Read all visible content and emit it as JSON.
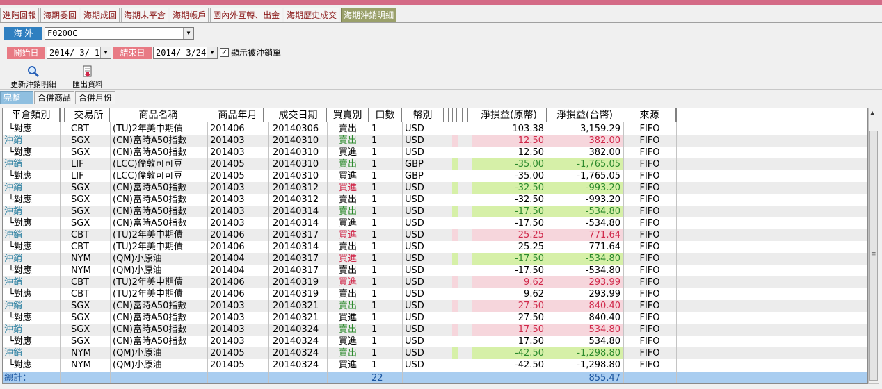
{
  "tabs": [
    "進階回報",
    "海期委回",
    "海期成回",
    "海期未平倉",
    "海期帳戶",
    "國內外互轉、出金",
    "海期歷史成交",
    "海期沖銷明細"
  ],
  "active_tab": 7,
  "market_label": "海 外",
  "account_value": "F0200C",
  "start_label": "開始日",
  "start_date": "2014/ 3/ 1",
  "end_label": "結束日",
  "end_date": "2014/ 3/24",
  "show_offset_label": "顯示被沖銷單",
  "show_offset_checked": true,
  "toolbar": {
    "refresh_label": "更新沖銷明細",
    "export_label": "匯出資料"
  },
  "subtabs": [
    "完整",
    "合併商品",
    "合併月份"
  ],
  "columns": [
    "平倉類別",
    "交易所",
    "商品名稱",
    "商品年月",
    "成交日期",
    "買賣別",
    "口數",
    "幣別",
    "淨損益(原幣)",
    "淨損益(台幣)",
    "來源"
  ],
  "rows": [
    {
      "type": "└對應",
      "ex": "CBT",
      "name": "(TU)2年美中期債",
      "ym": "201406",
      "date": "20140306",
      "side": "賣出",
      "qty": "1",
      "cur": "USD",
      "pl": "103.38",
      "twd": "3,159.29",
      "src": "FIFO",
      "kind": "match"
    },
    {
      "type": "沖銷",
      "ex": "SGX",
      "name": "(CN)富時A50指數",
      "ym": "201403",
      "date": "20140310",
      "side": "賣出",
      "qty": "1",
      "cur": "USD",
      "pl": "12.50",
      "twd": "382.00",
      "src": "FIFO",
      "kind": "offset",
      "sign": "pos"
    },
    {
      "type": "└對應",
      "ex": "SGX",
      "name": "(CN)富時A50指數",
      "ym": "201403",
      "date": "20140310",
      "side": "買進",
      "qty": "1",
      "cur": "USD",
      "pl": "12.50",
      "twd": "382.00",
      "src": "FIFO",
      "kind": "match"
    },
    {
      "type": "沖銷",
      "ex": "LIF",
      "name": "(LCC)倫敦可可豆",
      "ym": "201405",
      "date": "20140310",
      "side": "賣出",
      "qty": "1",
      "cur": "GBP",
      "pl": "-35.00",
      "twd": "-1,765.05",
      "src": "FIFO",
      "kind": "offset",
      "sign": "neg"
    },
    {
      "type": "└對應",
      "ex": "LIF",
      "name": "(LCC)倫敦可可豆",
      "ym": "201405",
      "date": "20140310",
      "side": "買進",
      "qty": "1",
      "cur": "GBP",
      "pl": "-35.00",
      "twd": "-1,765.05",
      "src": "FIFO",
      "kind": "match"
    },
    {
      "type": "沖銷",
      "ex": "SGX",
      "name": "(CN)富時A50指數",
      "ym": "201403",
      "date": "20140312",
      "side": "買進",
      "qty": "1",
      "cur": "USD",
      "pl": "-32.50",
      "twd": "-993.20",
      "src": "FIFO",
      "kind": "offset",
      "sign": "neg"
    },
    {
      "type": "└對應",
      "ex": "SGX",
      "name": "(CN)富時A50指數",
      "ym": "201403",
      "date": "20140312",
      "side": "賣出",
      "qty": "1",
      "cur": "USD",
      "pl": "-32.50",
      "twd": "-993.20",
      "src": "FIFO",
      "kind": "match"
    },
    {
      "type": "沖銷",
      "ex": "SGX",
      "name": "(CN)富時A50指數",
      "ym": "201403",
      "date": "20140314",
      "side": "賣出",
      "qty": "1",
      "cur": "USD",
      "pl": "-17.50",
      "twd": "-534.80",
      "src": "FIFO",
      "kind": "offset",
      "sign": "neg"
    },
    {
      "type": "└對應",
      "ex": "SGX",
      "name": "(CN)富時A50指數",
      "ym": "201403",
      "date": "20140314",
      "side": "買進",
      "qty": "1",
      "cur": "USD",
      "pl": "-17.50",
      "twd": "-534.80",
      "src": "FIFO",
      "kind": "match"
    },
    {
      "type": "沖銷",
      "ex": "CBT",
      "name": "(TU)2年美中期債",
      "ym": "201406",
      "date": "20140317",
      "side": "買進",
      "qty": "1",
      "cur": "USD",
      "pl": "25.25",
      "twd": "771.64",
      "src": "FIFO",
      "kind": "offset",
      "sign": "pos"
    },
    {
      "type": "└對應",
      "ex": "CBT",
      "name": "(TU)2年美中期債",
      "ym": "201406",
      "date": "20140314",
      "side": "賣出",
      "qty": "1",
      "cur": "USD",
      "pl": "25.25",
      "twd": "771.64",
      "src": "FIFO",
      "kind": "match"
    },
    {
      "type": "沖銷",
      "ex": "NYM",
      "name": "(QM)小原油",
      "ym": "201404",
      "date": "20140317",
      "side": "買進",
      "qty": "1",
      "cur": "USD",
      "pl": "-17.50",
      "twd": "-534.80",
      "src": "FIFO",
      "kind": "offset",
      "sign": "neg"
    },
    {
      "type": "└對應",
      "ex": "NYM",
      "name": "(QM)小原油",
      "ym": "201404",
      "date": "20140317",
      "side": "賣出",
      "qty": "1",
      "cur": "USD",
      "pl": "-17.50",
      "twd": "-534.80",
      "src": "FIFO",
      "kind": "match"
    },
    {
      "type": "沖銷",
      "ex": "CBT",
      "name": "(TU)2年美中期債",
      "ym": "201406",
      "date": "20140319",
      "side": "買進",
      "qty": "1",
      "cur": "USD",
      "pl": "9.62",
      "twd": "293.99",
      "src": "FIFO",
      "kind": "offset",
      "sign": "pos"
    },
    {
      "type": "└對應",
      "ex": "CBT",
      "name": "(TU)2年美中期債",
      "ym": "201406",
      "date": "20140319",
      "side": "賣出",
      "qty": "1",
      "cur": "USD",
      "pl": "9.62",
      "twd": "293.99",
      "src": "FIFO",
      "kind": "match"
    },
    {
      "type": "沖銷",
      "ex": "SGX",
      "name": "(CN)富時A50指數",
      "ym": "201403",
      "date": "20140321",
      "side": "賣出",
      "qty": "1",
      "cur": "USD",
      "pl": "27.50",
      "twd": "840.40",
      "src": "FIFO",
      "kind": "offset",
      "sign": "pos"
    },
    {
      "type": "└對應",
      "ex": "SGX",
      "name": "(CN)富時A50指數",
      "ym": "201403",
      "date": "20140321",
      "side": "買進",
      "qty": "1",
      "cur": "USD",
      "pl": "27.50",
      "twd": "840.40",
      "src": "FIFO",
      "kind": "match"
    },
    {
      "type": "沖銷",
      "ex": "SGX",
      "name": "(CN)富時A50指數",
      "ym": "201403",
      "date": "20140324",
      "side": "賣出",
      "qty": "1",
      "cur": "USD",
      "pl": "17.50",
      "twd": "534.80",
      "src": "FIFO",
      "kind": "offset",
      "sign": "pos"
    },
    {
      "type": "└對應",
      "ex": "SGX",
      "name": "(CN)富時A50指數",
      "ym": "201403",
      "date": "20140324",
      "side": "買進",
      "qty": "1",
      "cur": "USD",
      "pl": "17.50",
      "twd": "534.80",
      "src": "FIFO",
      "kind": "match"
    },
    {
      "type": "沖銷",
      "ex": "NYM",
      "name": "(QM)小原油",
      "ym": "201405",
      "date": "20140324",
      "side": "賣出",
      "qty": "1",
      "cur": "USD",
      "pl": "-42.50",
      "twd": "-1,298.80",
      "src": "FIFO",
      "kind": "offset",
      "sign": "neg"
    },
    {
      "type": "└對應",
      "ex": "NYM",
      "name": "(QM)小原油",
      "ym": "201405",
      "date": "20140324",
      "side": "買進",
      "qty": "1",
      "cur": "USD",
      "pl": "-42.50",
      "twd": "-1,298.80",
      "src": "FIFO",
      "kind": "match"
    }
  ],
  "total": {
    "label": "總計：",
    "qty": "22",
    "twd": "855.47"
  },
  "colors": {
    "tab_text": "#8b1a1a",
    "active_tab": "#9aa06a",
    "market_label_bg": "#2f7fc0",
    "date_label_bg": "#e87a84",
    "offset_text": "#2a7fa0",
    "buy": "#d0284a",
    "sell": "#2c8a2c",
    "pos_bg": "#f6d6dc",
    "pos_text": "#d0284a",
    "neg_bg": "#d6f0a8",
    "neg_text": "#2c8a2c",
    "total_bg": "#a9cdf0",
    "total_text": "#1a55a0"
  }
}
